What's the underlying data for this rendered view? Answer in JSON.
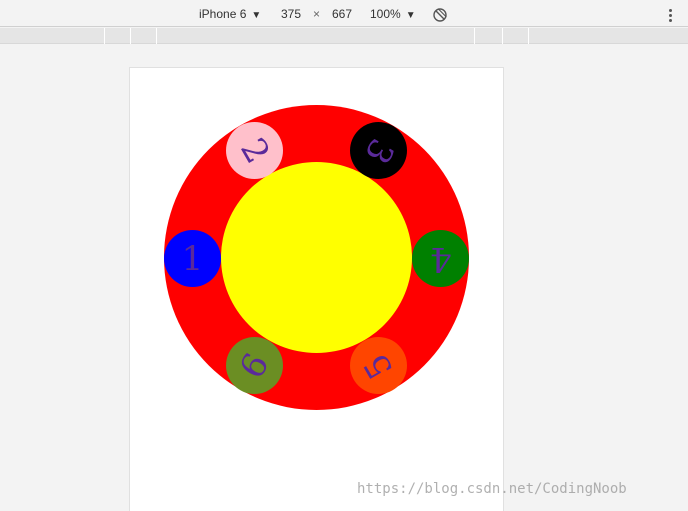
{
  "toolbar": {
    "device": "iPhone 6",
    "width": "375",
    "times": "×",
    "height": "667",
    "zoom": "100%"
  },
  "icons": {
    "device_arrow": "chevron-down-icon",
    "zoom_arrow": "chevron-down-icon",
    "rotate": "rotate-icon",
    "more": "more-vertical-icon"
  },
  "circles": [
    {
      "label": "1",
      "color": "#0000ff"
    },
    {
      "label": "2",
      "color": "#ffc0cb"
    },
    {
      "label": "3",
      "color": "#000000"
    },
    {
      "label": "4",
      "color": "#008000"
    },
    {
      "label": "5",
      "color": "#ff4500"
    },
    {
      "label": "6",
      "color": "#6b8e23"
    }
  ],
  "colors": {
    "outer_ring": "#ff0000",
    "inner_disc": "#ffff00",
    "number_text": "#5a2a9a"
  },
  "watermark": "https://blog.csdn.net/CodingNoob"
}
